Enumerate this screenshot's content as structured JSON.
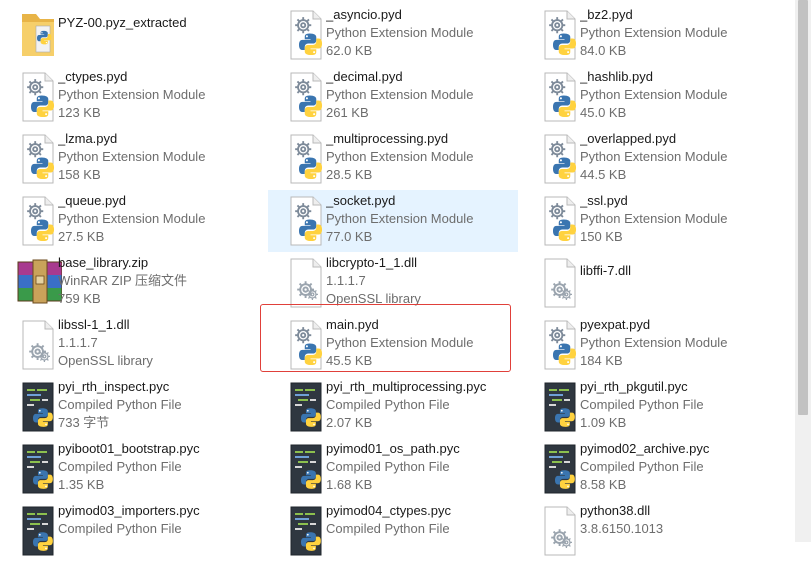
{
  "icon_names": {
    "folder": "zip-folder-icon",
    "pyd": "python-extension-icon",
    "dll": "dll-settings-icon",
    "pyc": "compiled-python-icon",
    "rar": "winrar-archive-icon"
  },
  "accent_colors": {
    "selection": "#e5f3ff",
    "focus_border": "#e0403a",
    "python_blue": "#3a75b0",
    "python_yellow": "#ffd23f"
  },
  "files": [
    {
      "name": "PYZ-00.pyz_extracted",
      "type": "folder",
      "lines": []
    },
    {
      "name": "_asyncio.pyd",
      "type": "pyd",
      "lines": [
        "Python Extension Module",
        "62.0 KB"
      ]
    },
    {
      "name": "_bz2.pyd",
      "type": "pyd",
      "lines": [
        "Python Extension Module",
        "84.0 KB"
      ]
    },
    {
      "name": "_ctypes.pyd",
      "type": "pyd",
      "lines": [
        "Python Extension Module",
        "123 KB"
      ]
    },
    {
      "name": "_decimal.pyd",
      "type": "pyd",
      "lines": [
        "Python Extension Module",
        "261 KB"
      ]
    },
    {
      "name": "_hashlib.pyd",
      "type": "pyd",
      "lines": [
        "Python Extension Module",
        "45.0 KB"
      ]
    },
    {
      "name": "_lzma.pyd",
      "type": "pyd",
      "lines": [
        "Python Extension Module",
        "158 KB"
      ]
    },
    {
      "name": "_multiprocessing.pyd",
      "type": "pyd",
      "lines": [
        "Python Extension Module",
        "28.5 KB"
      ]
    },
    {
      "name": "_overlapped.pyd",
      "type": "pyd",
      "lines": [
        "Python Extension Module",
        "44.5 KB"
      ]
    },
    {
      "name": "_queue.pyd",
      "type": "pyd",
      "lines": [
        "Python Extension Module",
        "27.5 KB"
      ]
    },
    {
      "name": "_socket.pyd",
      "type": "pyd",
      "lines": [
        "Python Extension Module",
        "77.0 KB"
      ],
      "selected": true
    },
    {
      "name": "_ssl.pyd",
      "type": "pyd",
      "lines": [
        "Python Extension Module",
        "150 KB"
      ]
    },
    {
      "name": "base_library.zip",
      "type": "rar",
      "lines": [
        "WinRAR ZIP 压缩文件",
        "759 KB"
      ]
    },
    {
      "name": "libcrypto-1_1.dll",
      "type": "dll",
      "lines": [
        "1.1.1.7",
        "OpenSSL library"
      ]
    },
    {
      "name": "libffi-7.dll",
      "type": "dll",
      "lines": []
    },
    {
      "name": "libssl-1_1.dll",
      "type": "dll",
      "lines": [
        "1.1.1.7",
        "OpenSSL library"
      ]
    },
    {
      "name": "main.pyd",
      "type": "pyd",
      "lines": [
        "Python Extension Module",
        "45.5 KB"
      ],
      "focused": true
    },
    {
      "name": "pyexpat.pyd",
      "type": "pyd",
      "lines": [
        "Python Extension Module",
        "184 KB"
      ]
    },
    {
      "name": "pyi_rth_inspect.pyc",
      "type": "pyc",
      "lines": [
        "Compiled Python File",
        "733 字节"
      ]
    },
    {
      "name": "pyi_rth_multiprocessing.pyc",
      "type": "pyc",
      "lines": [
        "Compiled Python File",
        "2.07 KB"
      ]
    },
    {
      "name": "pyi_rth_pkgutil.pyc",
      "type": "pyc",
      "lines": [
        "Compiled Python File",
        "1.09 KB"
      ]
    },
    {
      "name": "pyiboot01_bootstrap.pyc",
      "type": "pyc",
      "lines": [
        "Compiled Python File",
        "1.35 KB"
      ]
    },
    {
      "name": "pyimod01_os_path.pyc",
      "type": "pyc",
      "lines": [
        "Compiled Python File",
        "1.68 KB"
      ]
    },
    {
      "name": "pyimod02_archive.pyc",
      "type": "pyc",
      "lines": [
        "Compiled Python File",
        "8.58 KB"
      ]
    },
    {
      "name": "pyimod03_importers.pyc",
      "type": "pyc",
      "lines": [
        "Compiled Python File"
      ]
    },
    {
      "name": "pyimod04_ctypes.pyc",
      "type": "pyc",
      "lines": [
        "Compiled Python File"
      ]
    },
    {
      "name": "python38.dll",
      "type": "dll",
      "lines": [
        "3.8.6150.1013"
      ]
    }
  ]
}
